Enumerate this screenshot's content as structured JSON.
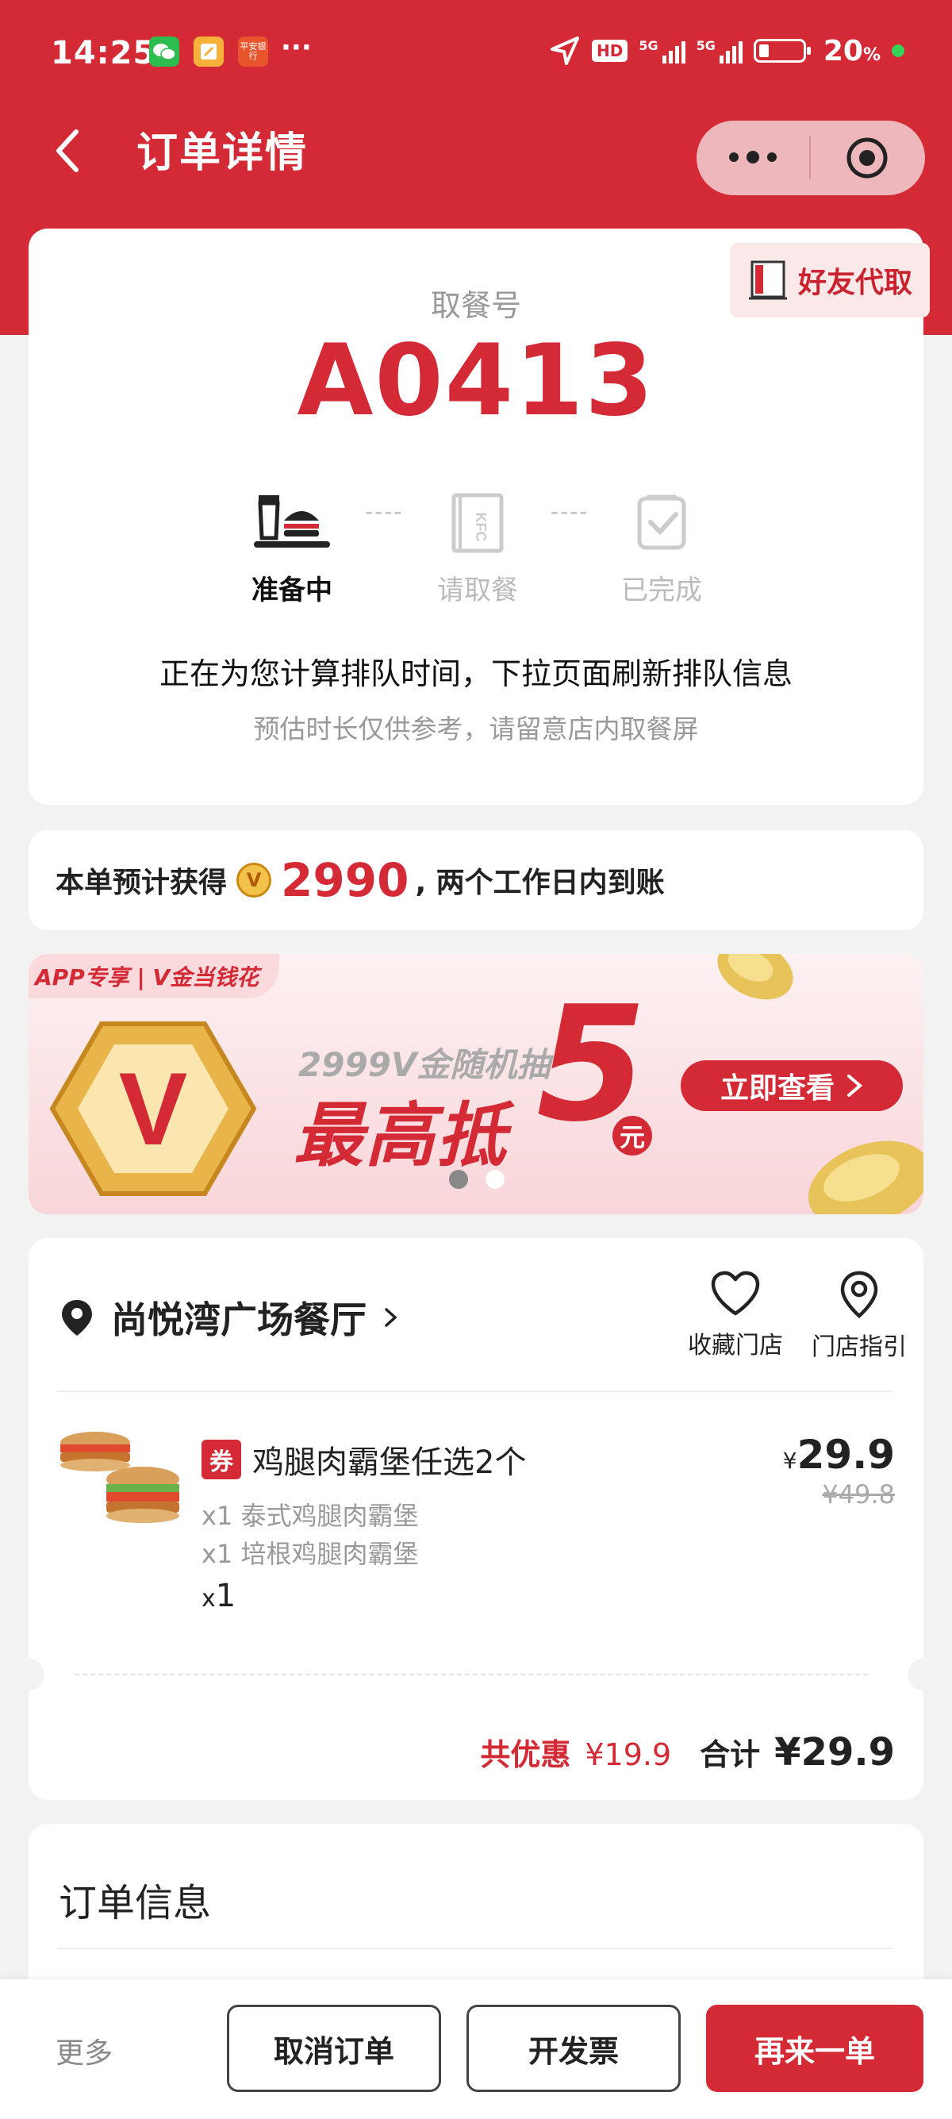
{
  "status_bar": {
    "time": "14:25",
    "battery_text": "20",
    "battery_unit": "%",
    "hd_badge": "HD",
    "net_5g_1": "5G",
    "net_5g_2": "5G",
    "apps": [
      "wechat-icon",
      "notes-icon",
      "pingan-bank-icon"
    ],
    "app3_text": "平安银行",
    "more_dots": "···"
  },
  "nav": {
    "title": "订单详情"
  },
  "friend_pickup": {
    "label": "好友代取",
    "icon_text": "KFC"
  },
  "pickup": {
    "label": "取餐号",
    "number": "A0413",
    "steps": [
      {
        "label": "准备中",
        "active": true
      },
      {
        "label": "请取餐",
        "active": false
      },
      {
        "label": "已完成",
        "active": false
      }
    ],
    "dash": "----",
    "message": "正在为您计算排队时间，下拉页面刷新排队信息",
    "submessage": "预估时长仅供参考，请留意店内取餐屏"
  },
  "points": {
    "prefix": "本单预计获得",
    "coin_letter": "V",
    "amount": "2990",
    "suffix": ", 两个工作日内到账"
  },
  "banner": {
    "tag": "APP专享 | V金当钱花",
    "line1": "2999V金随机抽",
    "line2": "最高抵",
    "big_number": "5",
    "unit": "元",
    "cta": "立即查看",
    "logo_letter": "V",
    "dots": 2,
    "active_dot": 0
  },
  "store": {
    "name": "尚悦湾广场餐厅",
    "favorite_label": "收藏门店",
    "guide_label": "门店指引"
  },
  "order_item": {
    "coupon_badge": "券",
    "name": "鸡腿肉霸堡任选2个",
    "options": [
      "x1 泰式鸡腿肉霸堡",
      "x1 培根鸡腿肉霸堡"
    ],
    "qty_prefix": "x",
    "qty": "1",
    "currency": "¥",
    "price": "29.9",
    "original_price": "¥49.8"
  },
  "totals": {
    "discount_label": "共优惠",
    "discount_value": "¥19.9",
    "total_label": "合计",
    "total_value": "¥29.9"
  },
  "order_info": {
    "title": "订单信息"
  },
  "bottom": {
    "more": "更多",
    "cancel": "取消订单",
    "invoice": "开发票",
    "reorder": "再来一单"
  },
  "colors": {
    "brand_red": "#d32a36",
    "page_bg": "#f2f2f2"
  }
}
